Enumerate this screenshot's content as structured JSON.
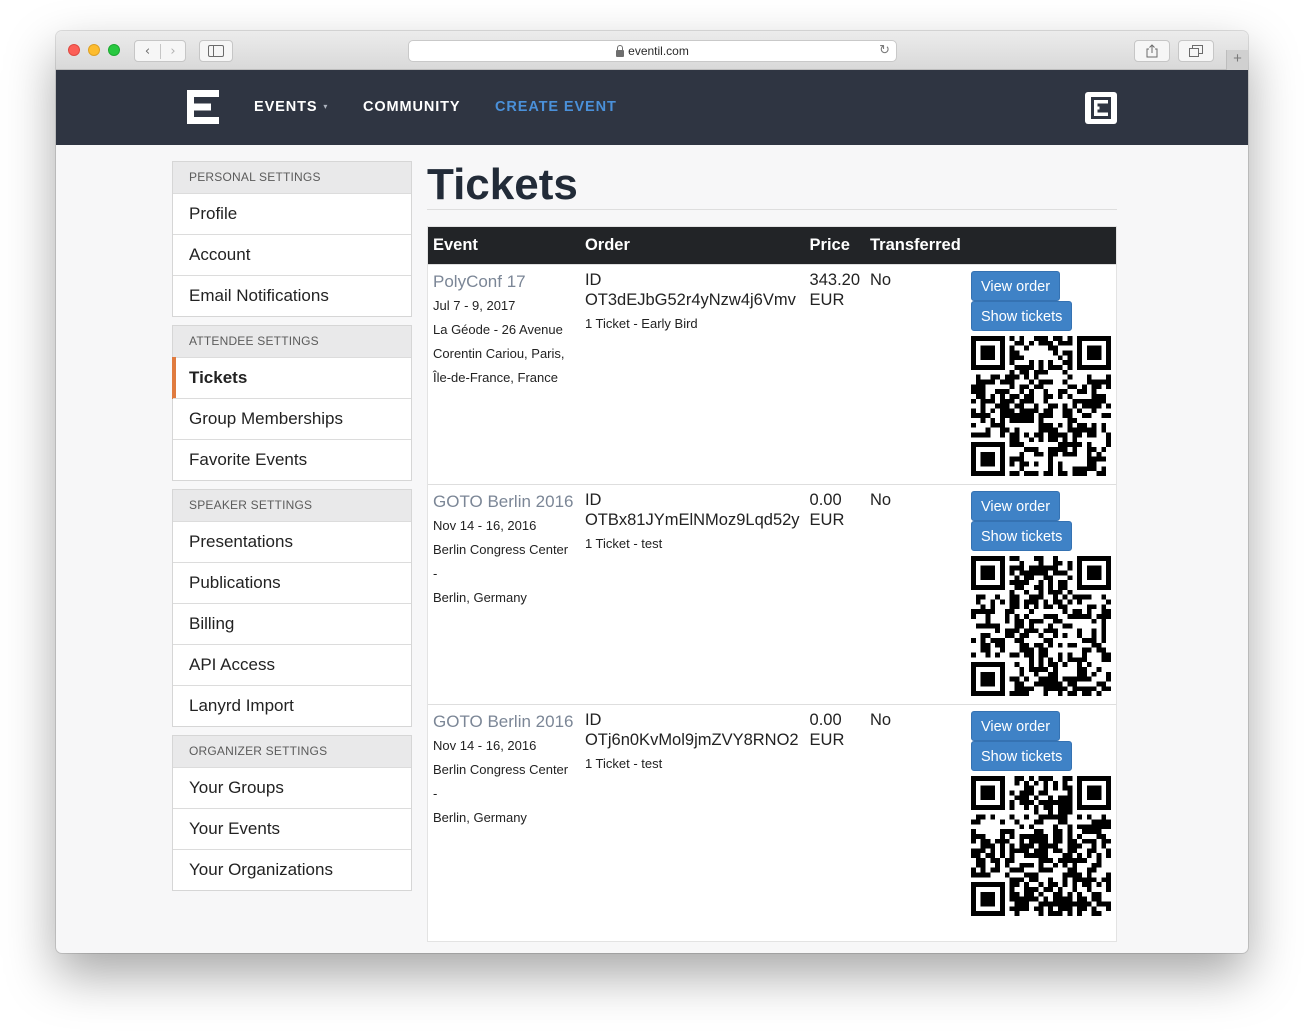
{
  "browser": {
    "url": "eventil.com",
    "back_glyph": "‹",
    "forward_glyph": "›",
    "reload_glyph": "↻",
    "newtab_glyph": "+"
  },
  "topnav": {
    "events": "EVENTS",
    "community": "COMMUNITY",
    "create_event": "CREATE EVENT",
    "accent_color": "#4a90d9",
    "bg_color": "#2f3542"
  },
  "sidebar": {
    "groups": [
      {
        "header": "PERSONAL SETTINGS",
        "items": [
          "Profile",
          "Account",
          "Email Notifications"
        ]
      },
      {
        "header": "ATTENDEE SETTINGS",
        "items": [
          "Tickets",
          "Group Memberships",
          "Favorite Events"
        ]
      },
      {
        "header": "SPEAKER SETTINGS",
        "items": [
          "Presentations",
          "Publications",
          "Billing",
          "API Access",
          "Lanyrd Import"
        ]
      },
      {
        "header": "ORGANIZER SETTINGS",
        "items": [
          "Your Groups",
          "Your Events",
          "Your Organizations"
        ]
      }
    ],
    "active_item": "Tickets",
    "active_color": "#e07b3f"
  },
  "main": {
    "title": "Tickets",
    "columns": [
      "Event",
      "Order",
      "Price",
      "Transferred"
    ],
    "rows": [
      {
        "event_name": "PolyConf 17",
        "event_date": "Jul 7 - 9, 2017",
        "event_location": [
          "La Géode - 26 Avenue",
          "Corentin Cariou, Paris,",
          "Île-de-France, France"
        ],
        "order_label": "ID",
        "order_id": "OT3dEJbG52r4yNzw4j6Vmv",
        "ticket_desc": "1 Ticket - Early Bird",
        "price_amount": "343.20",
        "price_currency": "EUR",
        "transferred": "No",
        "view_order": "View order",
        "show_tickets": "Show tickets"
      },
      {
        "event_name": "GOTO Berlin 2016",
        "event_date": "Nov 14 - 16, 2016",
        "event_location": [
          "Berlin Congress Center -",
          "Berlin, Germany"
        ],
        "order_label": "ID",
        "order_id": "OTBx81JYmElNMoz9Lqd52y",
        "ticket_desc": "1 Ticket - test",
        "price_amount": "0.00",
        "price_currency": "EUR",
        "transferred": "No",
        "view_order": "View order",
        "show_tickets": "Show tickets"
      },
      {
        "event_name": "GOTO Berlin 2016",
        "event_date": "Nov 14 - 16, 2016",
        "event_location": [
          "Berlin Congress Center -",
          "Berlin, Germany"
        ],
        "order_label": "ID",
        "order_id": "OTj6n0KvMol9jmZVY8RNO2",
        "ticket_desc": "1 Ticket - test",
        "price_amount": "0.00",
        "price_currency": "EUR",
        "transferred": "No",
        "view_order": "View order",
        "show_tickets": "Show tickets"
      }
    ],
    "button_color": "#3f82c6"
  }
}
